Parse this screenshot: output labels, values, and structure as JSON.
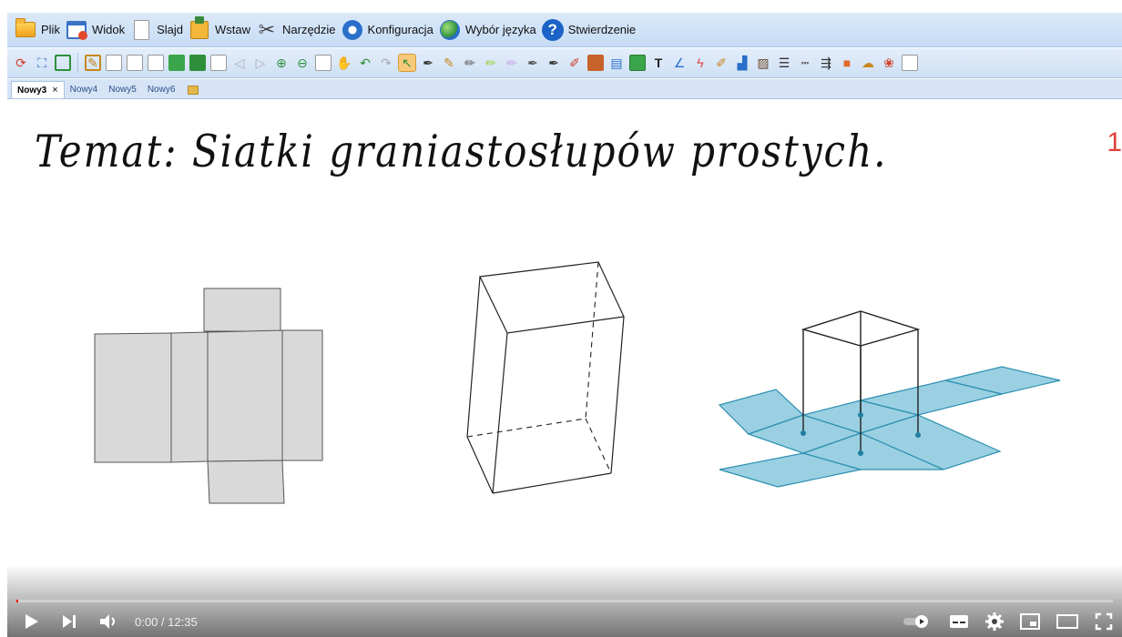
{
  "menu": [
    {
      "label": "Plik",
      "icon": "folder-icon"
    },
    {
      "label": "Widok",
      "icon": "window-icon"
    },
    {
      "label": "Slajd",
      "icon": "page-icon"
    },
    {
      "label": "Wstaw",
      "icon": "insert-icon"
    },
    {
      "label": "Narzędzie",
      "icon": "tools-icon"
    },
    {
      "label": "Konfiguracja",
      "icon": "gear-icon"
    },
    {
      "label": "Wybór języka",
      "icon": "globe-icon"
    },
    {
      "label": "Stwierdzenie",
      "icon": "help-icon"
    }
  ],
  "tabs": [
    {
      "label": "Nowy3",
      "active": true
    },
    {
      "label": "Nowy4"
    },
    {
      "label": "Nowy5"
    },
    {
      "label": "Nowy6"
    }
  ],
  "tab_close": "×",
  "canvas": {
    "title": "Temat: Siatki graniastosłupów prostych.",
    "page_number": "1",
    "colors": {
      "net_fill": "#d9d9d9",
      "cross_fill": "#78c0d8",
      "cross_stroke": "#2d90b0",
      "ink": "#222222"
    }
  },
  "player": {
    "time": "0:00 / 12:35",
    "progress": 0.0,
    "icons": [
      "play-icon",
      "next-icon",
      "volume-icon",
      "autoplay-icon",
      "subtitles-icon",
      "settings-icon",
      "miniplayer-icon",
      "theater-icon",
      "fullscreen-icon"
    ]
  }
}
